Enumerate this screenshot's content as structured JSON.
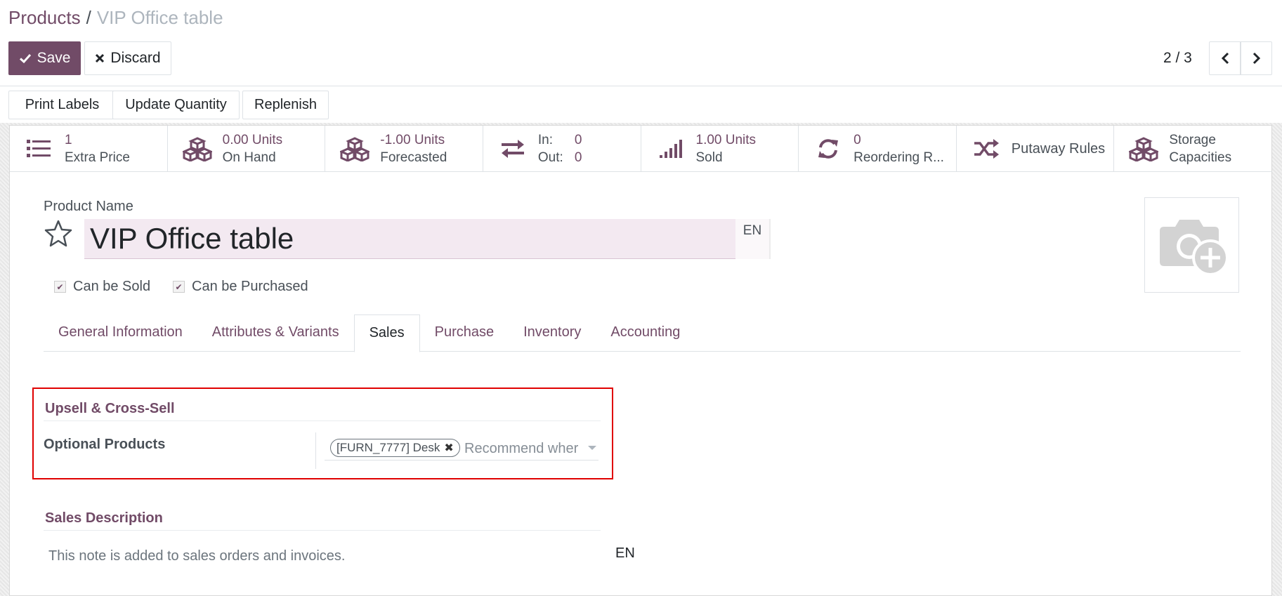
{
  "breadcrumb": {
    "parent": "Products",
    "separator": "/",
    "current": "VIP Office table"
  },
  "toolbar": {
    "save_label": "Save",
    "discard_label": "Discard"
  },
  "pager": {
    "value": "2 / 3"
  },
  "header_buttons": [
    "Print Labels",
    "Update Quantity",
    "Replenish"
  ],
  "stats": {
    "extra_price": {
      "value": "1",
      "label": "Extra Price"
    },
    "on_hand": {
      "value": "0.00 Units",
      "label": "On Hand"
    },
    "forecasted": {
      "value": "-1.00 Units",
      "label": "Forecasted"
    },
    "in_out": {
      "in_label": "In:",
      "in_value": "0",
      "out_label": "Out:",
      "out_value": "0"
    },
    "sold": {
      "value": "1.00 Units",
      "label": "Sold"
    },
    "reordering": {
      "value": "0",
      "label": "Reordering R..."
    },
    "putaway": {
      "label": "Putaway Rules"
    },
    "storage": {
      "line1": "Storage",
      "line2": "Capacities"
    }
  },
  "product": {
    "name_label": "Product Name",
    "name": "VIP Office table",
    "lang": "EN",
    "can_be_sold_label": "Can be Sold",
    "can_be_purchased_label": "Can be Purchased",
    "can_be_sold": true,
    "can_be_purchased": true
  },
  "tabs": [
    "General Information",
    "Attributes & Variants",
    "Sales",
    "Purchase",
    "Inventory",
    "Accounting"
  ],
  "active_tab": "Sales",
  "sales": {
    "upsell_title": "Upsell & Cross-Sell",
    "optional_products_label": "Optional Products",
    "optional_tag": "[FURN_7777] Desk",
    "optional_placeholder": "Recommend wher",
    "description_title": "Sales Description",
    "description_placeholder": "This note is added to sales orders and invoices.",
    "description_lang": "EN"
  },
  "colors": {
    "brand": "#714B67",
    "highlight": "#e00000"
  }
}
